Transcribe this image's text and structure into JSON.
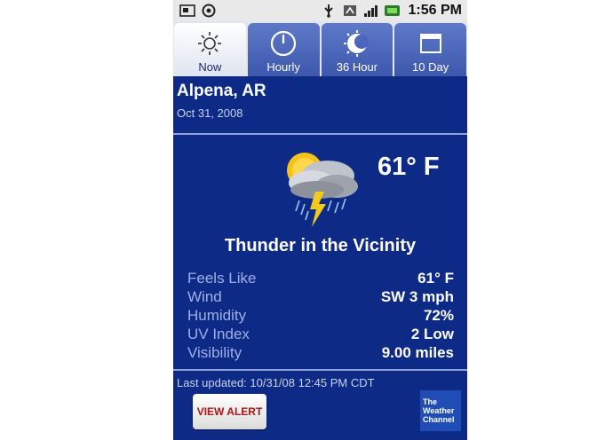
{
  "status_bar": {
    "time": "1:56 PM",
    "left_icons": [
      "notification-icon",
      "sync-icon"
    ],
    "right_icons": [
      "usb-icon",
      "data-icon",
      "signal-icon",
      "battery-icon"
    ]
  },
  "tabs": [
    {
      "label": "Now",
      "icon": "sun-icon",
      "active": true
    },
    {
      "label": "Hourly",
      "icon": "clock-icon",
      "active": false
    },
    {
      "label": "36 Hour",
      "icon": "day-night-icon",
      "active": false
    },
    {
      "label": "10 Day",
      "icon": "calendar-icon",
      "active": false
    }
  ],
  "header": {
    "location": "Alpena, AR",
    "date": "Oct 31, 2008"
  },
  "current": {
    "icon": "thunderstorm-icon",
    "temperature": "61° F",
    "condition": "Thunder in the Vicinity"
  },
  "details": [
    {
      "label": "Feels Like",
      "value": "61° F"
    },
    {
      "label": "Wind",
      "value": "SW 3 mph"
    },
    {
      "label": "Humidity",
      "value": "72%"
    },
    {
      "label": "UV Index",
      "value": "2 Low"
    },
    {
      "label": "Visibility",
      "value": "9.00 miles"
    }
  ],
  "footer": {
    "last_updated": "Last updated: 10/31/08 12:45 PM CDT",
    "alert_button": "VIEW ALERT",
    "logo_lines": [
      "The",
      "Weather",
      "Channel"
    ]
  },
  "colors": {
    "background": "#0d2a86",
    "tab_active": "#ffffff",
    "tab_inactive": "#4b66ba",
    "alert_text": "#b01515",
    "logo": "#1f4cb5"
  }
}
